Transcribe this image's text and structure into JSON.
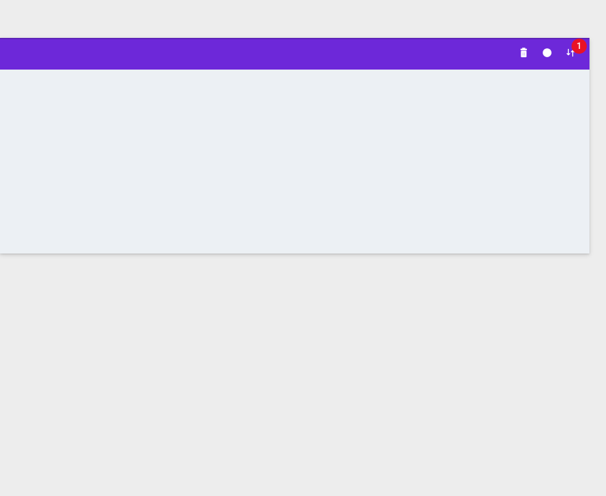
{
  "colors": {
    "page_bg": "#ededed",
    "card_bg": "#ecf0f4",
    "toolbar_bg": "#6d28d9",
    "badge_bg": "#e91225",
    "icon_fg": "#ffffff"
  },
  "toolbar": {
    "actions": [
      {
        "name": "delete",
        "icon": "trash-icon"
      },
      {
        "name": "history",
        "icon": "clock-icon"
      },
      {
        "name": "sort",
        "icon": "sort-icon",
        "badge": "1"
      }
    ]
  }
}
